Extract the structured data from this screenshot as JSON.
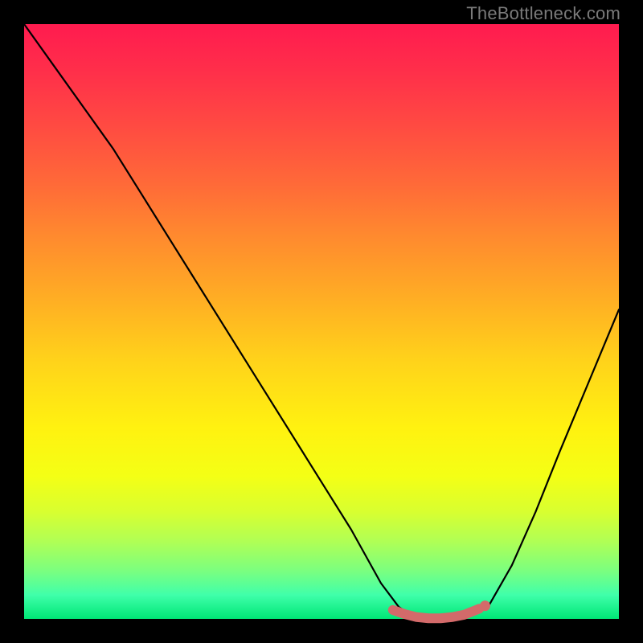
{
  "watermark": "TheBottleneck.com",
  "chart_data": {
    "type": "line",
    "title": "",
    "xlabel": "",
    "ylabel": "",
    "xlim": [
      0,
      1
    ],
    "ylim": [
      0,
      1
    ],
    "grid": false,
    "legend": false,
    "series": [
      {
        "name": "bottleneck-curve",
        "color": "#000000",
        "x": [
          0.0,
          0.05,
          0.1,
          0.15,
          0.2,
          0.25,
          0.3,
          0.35,
          0.4,
          0.45,
          0.5,
          0.55,
          0.6,
          0.63,
          0.66,
          0.7,
          0.74,
          0.78,
          0.82,
          0.86,
          0.9,
          0.95,
          1.0
        ],
        "y": [
          1.0,
          0.93,
          0.86,
          0.79,
          0.71,
          0.63,
          0.55,
          0.47,
          0.39,
          0.31,
          0.23,
          0.15,
          0.06,
          0.02,
          0.0,
          0.0,
          0.0,
          0.02,
          0.09,
          0.18,
          0.28,
          0.4,
          0.52
        ]
      }
    ],
    "markers": [
      {
        "name": "optimal-range",
        "color": "#d36a6a",
        "x": [
          0.62,
          0.64,
          0.66,
          0.68,
          0.7,
          0.72,
          0.74,
          0.765
        ],
        "y": [
          0.015,
          0.008,
          0.003,
          0.001,
          0.001,
          0.003,
          0.007,
          0.017
        ]
      }
    ]
  }
}
